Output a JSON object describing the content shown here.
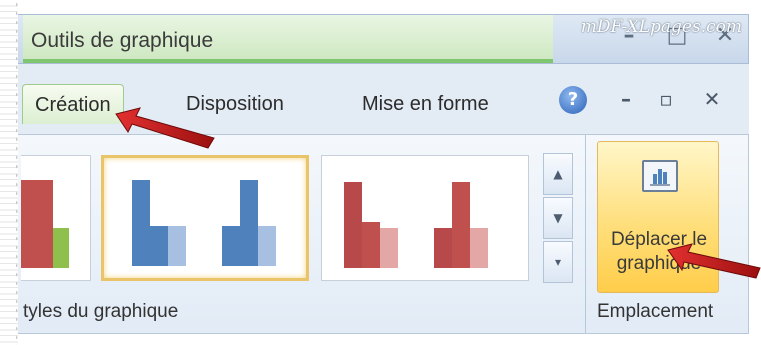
{
  "watermark": "mDF-XLpages.com",
  "titlebar": {
    "context_title": "Outils de graphique",
    "window_controls": {
      "minimize": "–",
      "restore": "□",
      "close": "✕"
    }
  },
  "tabs": [
    {
      "label": "Création",
      "active": true
    },
    {
      "label": "Disposition",
      "active": false
    },
    {
      "label": "Mise en forme",
      "active": false
    }
  ],
  "ribbon_controls": {
    "help": "?",
    "minimize": "–",
    "restore": "▫",
    "close": "✕"
  },
  "gallery": {
    "group_label": "tyles du graphique",
    "scroll_up": "▲",
    "scroll_down": "▼",
    "more": "▾"
  },
  "location_group": {
    "button_label": "Déplacer le graphique",
    "group_label": "Emplacement"
  },
  "colors": {
    "accent_green": "#7fc66e",
    "arrow_red": "#cc1d1d",
    "selection_gold": "#e9c46a"
  }
}
